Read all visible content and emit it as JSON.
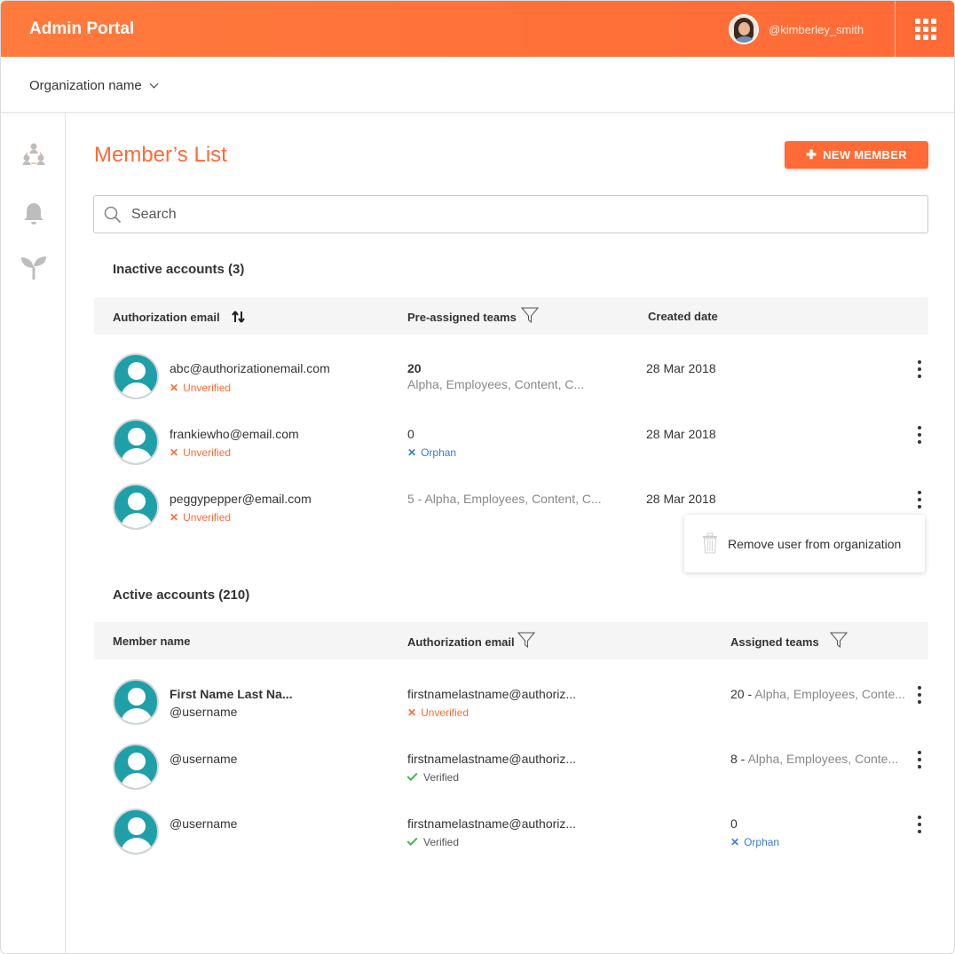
{
  "header": {
    "app_title": "Admin Portal",
    "username": "@kimberley_smith"
  },
  "org": {
    "name": "Organization name"
  },
  "sidebar": {
    "items": [
      {
        "icon": "team-icon"
      },
      {
        "icon": "bell-icon"
      },
      {
        "icon": "sprout-icon"
      }
    ]
  },
  "main": {
    "title": "Member’s List",
    "new_member_label": "NEW MEMBER",
    "search_placeholder": "Search"
  },
  "inactive": {
    "title": "Inactive accounts (3)",
    "columns": [
      "Authorization email",
      "Pre-assigned teams",
      "Created date"
    ],
    "rows": [
      {
        "email": "abc@authorizationemail.com",
        "status": "Unverified",
        "teams_count": "20",
        "teams_list": "Alpha, Employees, Content, C...",
        "date": "28 Mar 2018"
      },
      {
        "email": "frankiewho@email.com",
        "status": "Unverified",
        "teams_count": "0",
        "teams_list": "Orphan",
        "date": "28 Mar 2018"
      },
      {
        "email": "peggypepper@email.com",
        "status": "Unverified",
        "teams_inline": "5 - Alpha, Employees, Content, C...",
        "date": "28 Mar 2018"
      }
    ],
    "menu": {
      "remove_label": "Remove user from organization"
    }
  },
  "active": {
    "title": "Active accounts (210)",
    "columns": [
      "Member name",
      "Authorization email",
      "Assigned teams"
    ],
    "rows": [
      {
        "name": "First Name Last Na...",
        "username": "@username",
        "email": "firstnamelastname@authoriz...",
        "status": "Unverified",
        "teams_count": "20",
        "teams_list": "Alpha, Employees, Conte..."
      },
      {
        "username": "@username",
        "email": "firstnamelastname@authoriz...",
        "status": "Verified",
        "teams_count": "8",
        "teams_list": "Alpha, Employees, Conte..."
      },
      {
        "username": "@username",
        "email": "firstnamelastname@authoriz...",
        "status": "Verified",
        "teams_count": "0",
        "teams_list": "Orphan"
      }
    ]
  },
  "colors": {
    "accent": "#ff6a36",
    "avatar": "#1fa0a9",
    "orphan": "#3b7bd4",
    "verified": "#4caf50"
  }
}
